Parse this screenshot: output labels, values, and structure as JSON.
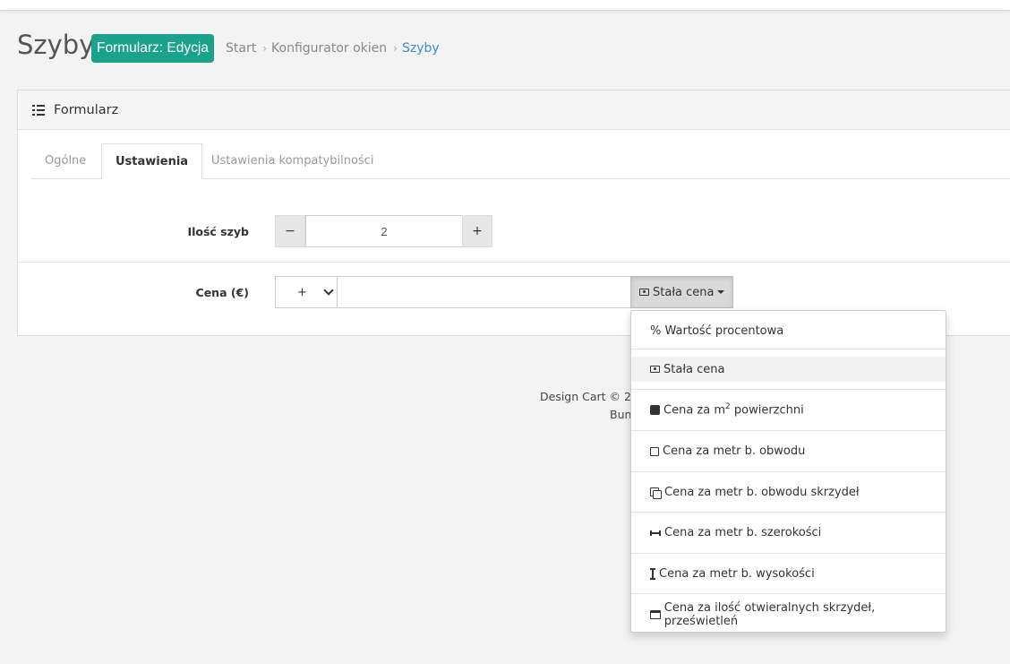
{
  "header": {
    "title": "Szyby",
    "badge": "Formularz: Edycja",
    "breadcrumb": [
      "Start",
      "Konfigurator okien",
      "Szyby"
    ]
  },
  "panel": {
    "title": "Formularz",
    "tabs": [
      {
        "label": "Ogólne",
        "active": false
      },
      {
        "label": "Ustawienia",
        "active": true
      },
      {
        "label": "Ustawienia kompatybilności",
        "active": false
      }
    ]
  },
  "form": {
    "glass_count": {
      "label": "Ilość szyb",
      "minus": "−",
      "plus": "+",
      "value": "2"
    },
    "price": {
      "label": "Cena (€)",
      "sign_selected": "+",
      "value": "",
      "type_button": "Stała cena"
    }
  },
  "footer": {
    "line1": "Design Cart © 20",
    "line2": "Bun"
  },
  "price_menu": {
    "items": [
      {
        "label": "% Wartość procentowa",
        "icon": "percent-icon"
      },
      {
        "label": "Stała cena",
        "icon": "money-icon",
        "selected": true
      },
      {
        "label_pre": "Cena za m",
        "sup": "2",
        "label_post": " powierzchni",
        "icon": "square-filled-icon"
      },
      {
        "label": "Cena za metr b. obwodu",
        "icon": "square-outline-icon"
      },
      {
        "label": "Cena za metr b. obwodu skrzydeł",
        "icon": "copy-icon"
      },
      {
        "label": "Cena za metr b. szerokości",
        "icon": "arrows-h-icon"
      },
      {
        "label": "Cena za metr b. wysokości",
        "icon": "arrows-v-icon"
      },
      {
        "label": "Cena za ilość otwieralnych skrzydeł, prześwietleń",
        "icon": "window-icon"
      }
    ]
  },
  "colors": {
    "badge": "#1ba28c",
    "link_active": "#3a8fce",
    "background": "#f3f3f3"
  }
}
